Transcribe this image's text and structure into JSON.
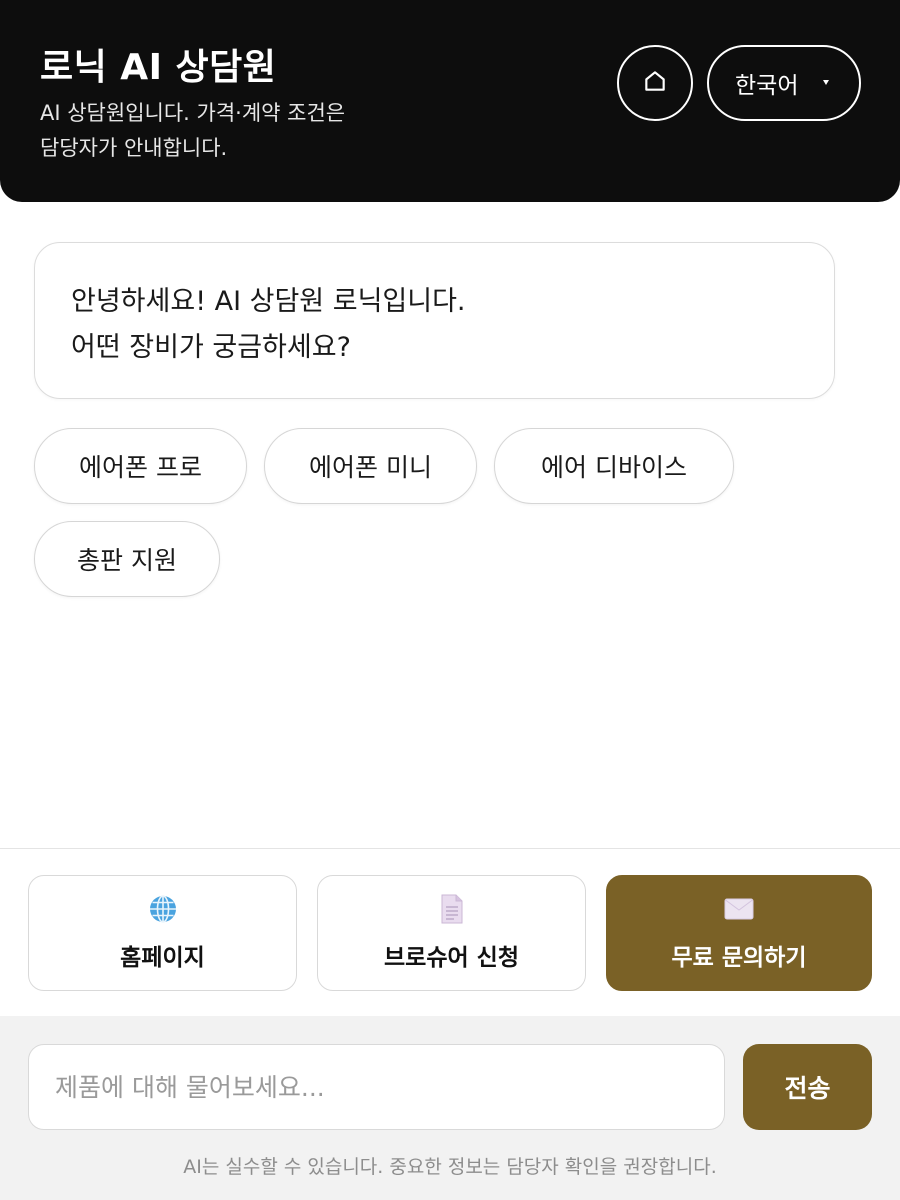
{
  "header": {
    "title": "로닉 AI 상담원",
    "subtitle": "AI 상담원입니다. 가격·계약 조건은 담당자가 안내합니다.",
    "home_icon": "home-icon",
    "language": "한국어"
  },
  "chat": {
    "greeting_line1": "안녕하세요! AI 상담원 로닉입니다.",
    "greeting_line2": "어떤 장비가 궁금하세요?",
    "suggestions": [
      "에어폰 프로",
      "에어폰 미니",
      "에어 디바이스",
      "총판 지원"
    ]
  },
  "actions": [
    {
      "label": "홈페이지",
      "icon": "globe-icon"
    },
    {
      "label": "브로슈어 신청",
      "icon": "document-icon"
    },
    {
      "label": "무료 문의하기",
      "icon": "envelope-icon"
    }
  ],
  "composer": {
    "placeholder": "제품에 대해 물어보세요...",
    "send_label": "전송",
    "disclaimer": "AI는 실수할 수 있습니다. 중요한 정보는 담당자 확인을 권장합니다."
  },
  "colors": {
    "header_bg": "#0d0d0d",
    "accent": "#7a6126"
  }
}
